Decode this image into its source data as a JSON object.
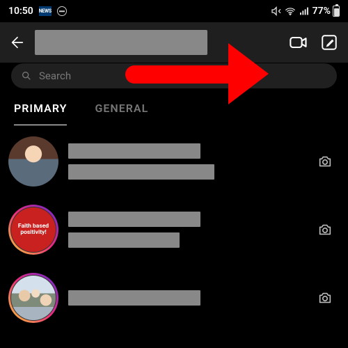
{
  "statusbar": {
    "time": "10:50",
    "news_badge": "NEWS",
    "battery_pct": "77%"
  },
  "search": {
    "placeholder": "Search"
  },
  "tabs": {
    "primary": "PRIMARY",
    "general": "GENERAL"
  },
  "avatars": {
    "faith_text": "Faith based positivity!"
  }
}
